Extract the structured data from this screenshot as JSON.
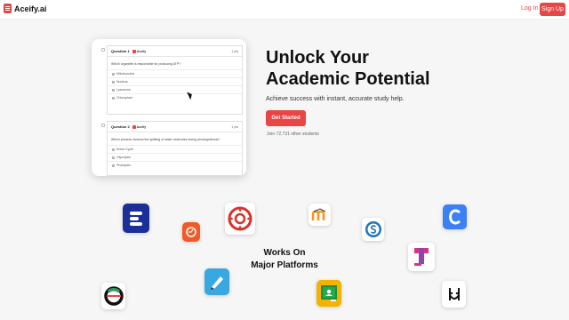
{
  "brand": {
    "name": "Aceify.ai",
    "accent": "#e84545"
  },
  "nav": {
    "login": "Log In",
    "signup": "Sign Up"
  },
  "hero": {
    "heading_line1": "Unlock Your",
    "heading_line2": "Academic Potential",
    "subtitle": "Achieve success with instant, accurate study help.",
    "cta": "Get Started",
    "join_text": "Join 72,731 other students"
  },
  "quiz": {
    "badge": "Aceify",
    "questions": [
      {
        "title": "Question 1",
        "points": "1 pts",
        "text": "Which organelle is responsible for producing ATP?",
        "options": [
          "Mitochondria",
          "Nucleus",
          "Lysosome",
          "Chloroplast"
        ]
      },
      {
        "title": "Question 2",
        "points": "1 pts",
        "text": "Which process involves the splitting of water molecules during photosynthesis?",
        "options": [
          "Krebs Cycle",
          "Glycolysis",
          "Photolysis"
        ]
      }
    ]
  },
  "platforms": {
    "title_line1": "Works On",
    "title_line2": "Major Platforms",
    "icons": [
      "edmentum-icon",
      "pearson-icon",
      "canvas-icon",
      "moodle-icon",
      "schoology-icon",
      "cengage-icon",
      "top-hat-icon",
      "d2l-icon",
      "pencil-icon",
      "google-classroom-icon",
      "wooclap-icon"
    ]
  }
}
